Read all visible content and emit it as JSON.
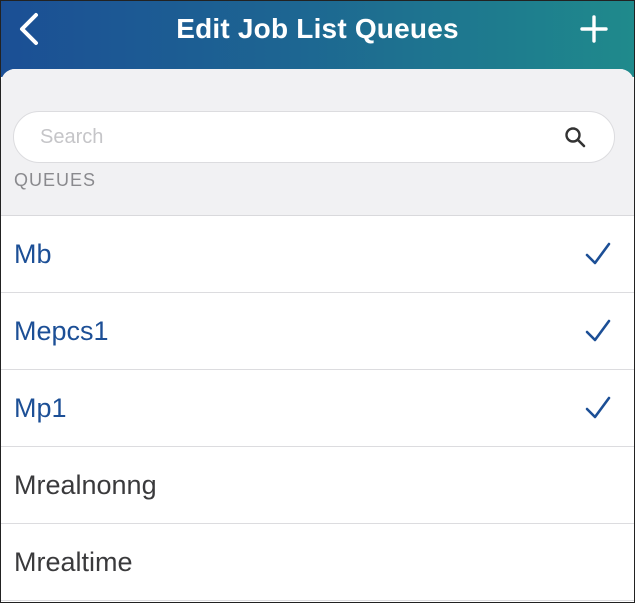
{
  "header": {
    "title": "Edit Job List Queues",
    "back_icon": "chevron-left-icon",
    "add_icon": "plus-icon"
  },
  "search": {
    "placeholder": "Search",
    "value": "",
    "icon": "search-icon"
  },
  "section": {
    "label": "QUEUES"
  },
  "queues": [
    {
      "label": "Mb",
      "selected": true
    },
    {
      "label": "Mepcs1",
      "selected": true
    },
    {
      "label": "Mp1",
      "selected": true
    },
    {
      "label": "Mrealnonng",
      "selected": false
    },
    {
      "label": "Mrealtime",
      "selected": false
    }
  ],
  "colors": {
    "header_start": "#1b4f95",
    "header_end": "#1f8a8c",
    "selected_text": "#1c4f96",
    "unselected_text": "#3a3a3c",
    "section_label": "#8a8a8e"
  }
}
